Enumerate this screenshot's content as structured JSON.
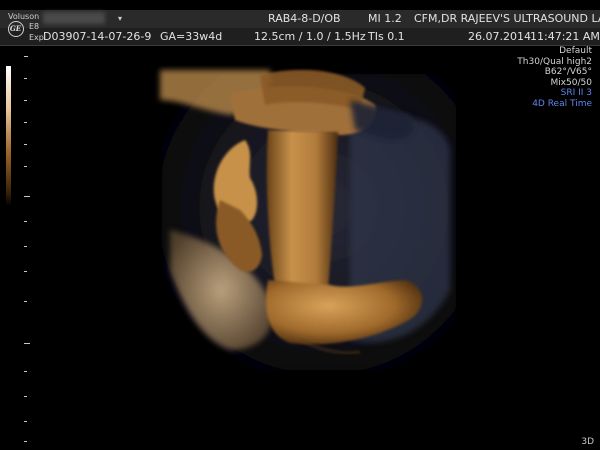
{
  "header": {
    "brand": "Voluson",
    "mode_a": "E8",
    "mode_b": "Exp",
    "chevron": "▾",
    "probe": "RAB4-8-D/OB",
    "mi": "MI  1.2",
    "clinic": "CFM,DR RAJEEV'S ULTRASOUND LAI",
    "patient_id": "D03907-14-07-26-9",
    "ga": "GA=33w4d",
    "depth": "12.5cm / 1.0 / 1.5Hz",
    "tis": "TIs  0.1",
    "date": "26.07.2014",
    "time": "11:47:21 AM"
  },
  "settings": {
    "preset": "Default",
    "quality": "Th30/Qual high2",
    "angles": "B62°/V65°",
    "mix": "Mix50/50",
    "sri": "SRI II 3",
    "mode_label": "4D Real Time"
  },
  "footer": {
    "view": "3D"
  },
  "colors": {
    "accent_blue": "#5f86e8",
    "render_tone": "#c8914a"
  }
}
